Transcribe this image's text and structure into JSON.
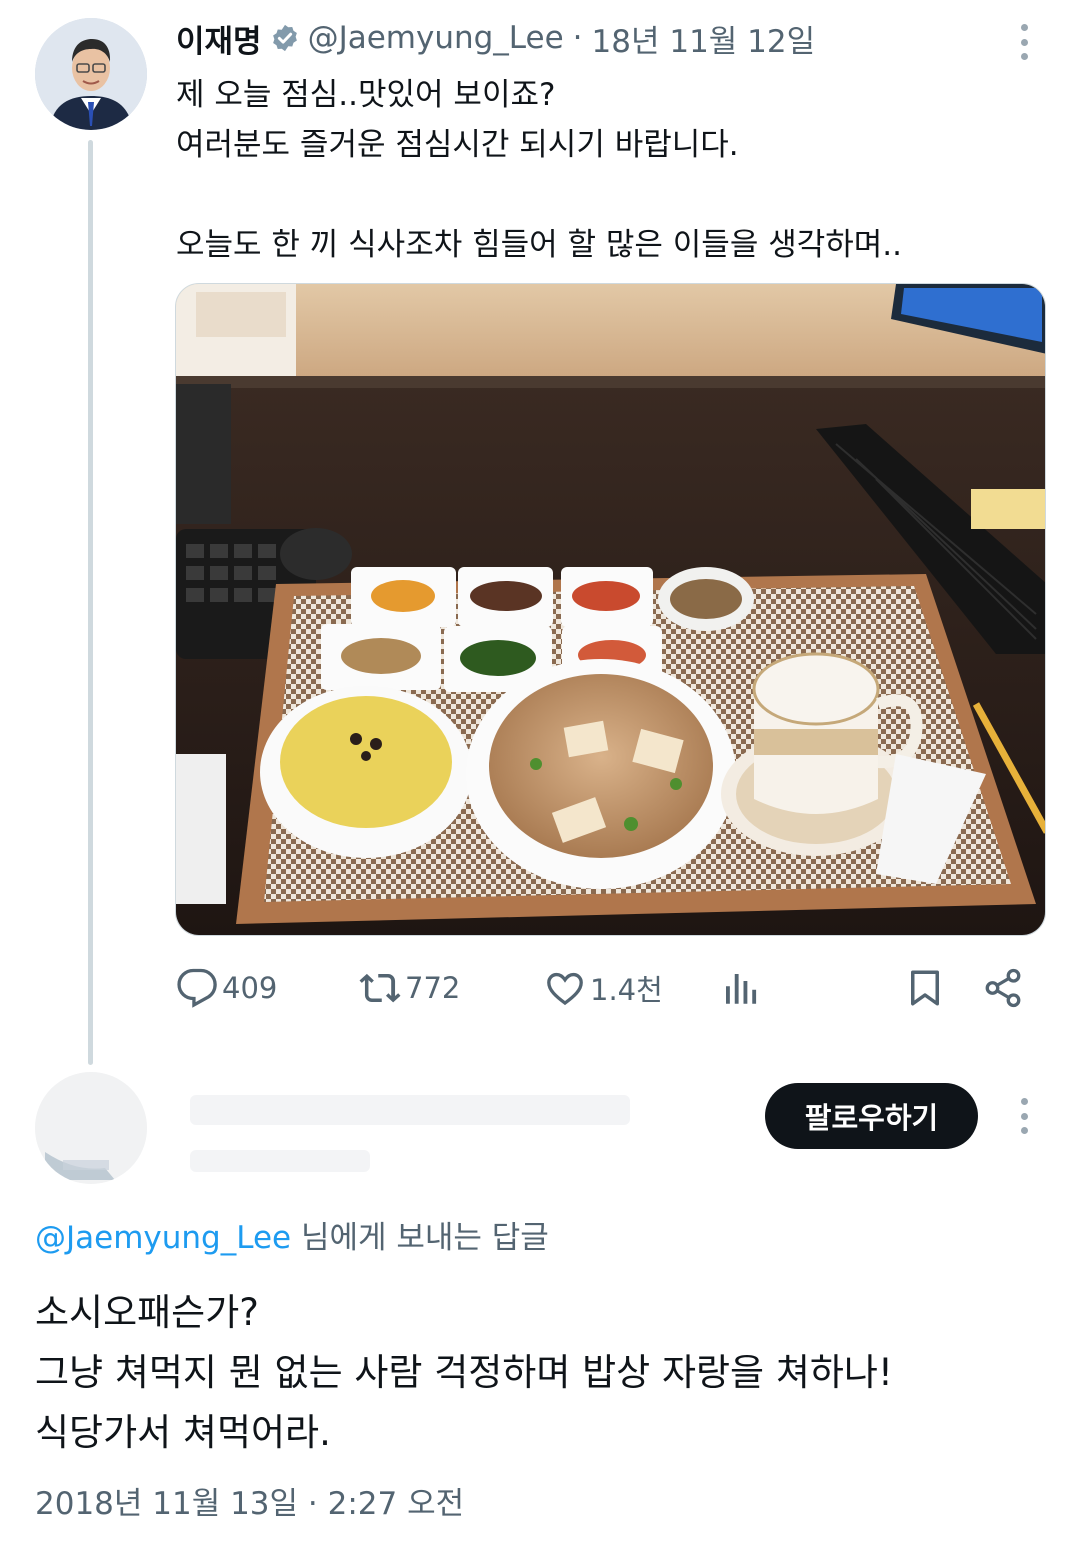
{
  "tweet": {
    "author_name": "이재명",
    "author_handle": "@Jaemyung_Lee",
    "separator": "·",
    "date": "18년 11월 12일",
    "text": "제 오늘 점심..맛있어 보이죠?\n여러분도 즐거운 점심시간 되시기 바랍니다.\n\n오늘도 한 끼 식사조차 힘들어 할 많은 이들을 생각하며..",
    "photo_description_icon": "lunch-tray-photo",
    "stats": {
      "replies": "409",
      "retweets": "772",
      "likes": "1.4천"
    }
  },
  "reply": {
    "follow_label": "팔로우하기",
    "reply_to_handle": "@Jaemyung_Lee",
    "reply_to_suffix": " 님에게 보내는 답글",
    "text": "소시오패슨가?\n그냥 쳐먹지 뭔 없는 사람 걱정하며 밥상 자랑을 쳐하나!\n식당가서 쳐먹어라.",
    "timestamp": "2018년 11월 13일 · 2:27 오전"
  },
  "colors": {
    "text_primary": "#0f1419",
    "text_secondary": "#536471",
    "accent": "#1d9bf0",
    "thread_line": "#cfd9de"
  }
}
